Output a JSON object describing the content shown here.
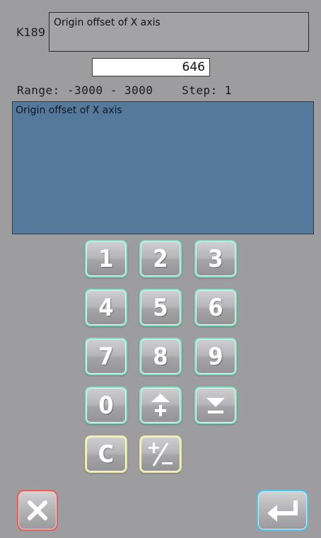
{
  "header": {
    "param_code": "K189",
    "param_title": "Origin offset of X axis"
  },
  "value_field": {
    "value": "646"
  },
  "range": {
    "label": "Range:",
    "min": "-3000",
    "separator": "-",
    "max": "3000",
    "step_label": "Step:",
    "step": "1"
  },
  "description": {
    "text": "Origin offset of X axis"
  },
  "keypad": {
    "k1": "1",
    "k2": "2",
    "k3": "3",
    "k4": "4",
    "k5": "5",
    "k6": "6",
    "k7": "7",
    "k8": "8",
    "k9": "9",
    "k0": "0",
    "clear": "C",
    "increment_icon": "plus-arrow-up-icon",
    "decrement_icon": "minus-arrow-down-icon",
    "sign_icon": "plus-minus-icon"
  },
  "actions": {
    "cancel_icon": "close-icon",
    "enter_icon": "enter-return-icon"
  },
  "colors": {
    "background": "#9d9d9f",
    "description_panel": "#54799a",
    "key_border": "#7fe6c2",
    "key_border_yellow": "#ece89a",
    "cancel_border": "#e36060",
    "enter_border": "#52c3ea"
  }
}
